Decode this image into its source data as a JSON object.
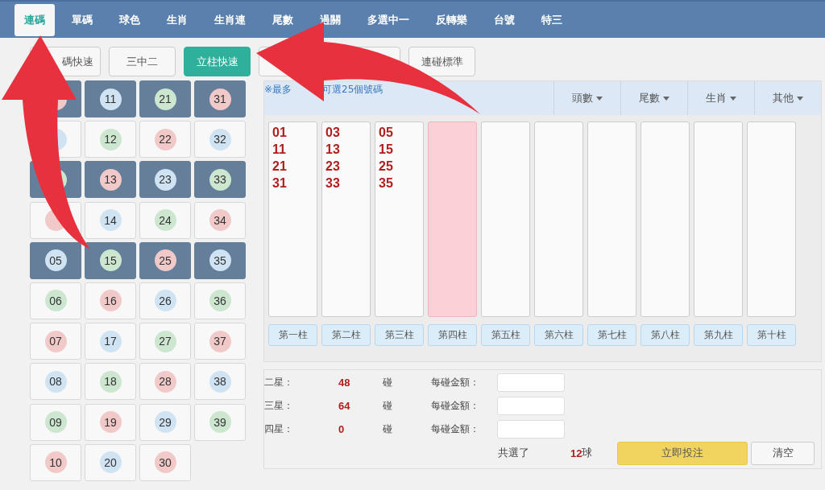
{
  "tabs": [
    {
      "label": "連碼",
      "selected": true
    },
    {
      "label": "單碼",
      "selected": false
    },
    {
      "label": "球色",
      "selected": false
    },
    {
      "label": "生肖",
      "selected": false
    },
    {
      "label": "生肖連",
      "selected": false
    },
    {
      "label": "尾數",
      "selected": false
    },
    {
      "label": "過關",
      "selected": false
    },
    {
      "label": "多選中一",
      "selected": false
    },
    {
      "label": "反轉樂",
      "selected": false
    },
    {
      "label": "台號",
      "selected": false
    },
    {
      "label": "特三",
      "selected": false
    }
  ],
  "mode_buttons": [
    {
      "label": "碼快速",
      "selected": false
    },
    {
      "label": "三中二",
      "selected": false
    },
    {
      "label": "立柱快速",
      "selected": true
    },
    {
      "selected": false
    },
    {
      "label": "連碰標準",
      "selected": false
    }
  ],
  "ball_columns": [
    [
      {
        "color": "#f2c9c9",
        "selected": true
      },
      {
        "color": "#cfe3f3",
        "selected": false
      },
      {
        "color": "#cde6cf",
        "selected": true
      },
      {
        "color": "#f2c9c9",
        "selected": false
      },
      {
        "number": "05",
        "color": "#cfe3f3",
        "selected": true
      },
      {
        "number": "06",
        "color": "#cde6cf",
        "selected": false
      },
      {
        "number": "07",
        "color": "#f2c9c9",
        "selected": false
      },
      {
        "number": "08",
        "color": "#cfe3f3",
        "selected": false
      },
      {
        "number": "09",
        "color": "#cde6cf",
        "selected": false
      },
      {
        "number": "10",
        "color": "#f2c9c9",
        "selected": false
      }
    ],
    [
      {
        "number": "11",
        "color": "#cfe3f3",
        "selected": true
      },
      {
        "number": "12",
        "color": "#cde6cf",
        "selected": false
      },
      {
        "number": "13",
        "color": "#f2c9c9",
        "selected": true
      },
      {
        "number": "14",
        "color": "#cfe3f3",
        "selected": false
      },
      {
        "number": "15",
        "color": "#cde6cf",
        "selected": true
      },
      {
        "number": "16",
        "color": "#f2c9c9",
        "selected": false
      },
      {
        "number": "17",
        "color": "#cfe3f3",
        "selected": false
      },
      {
        "number": "18",
        "color": "#cde6cf",
        "selected": false
      },
      {
        "number": "19",
        "color": "#f2c9c9",
        "selected": false
      },
      {
        "number": "20",
        "color": "#cfe3f3",
        "selected": false
      }
    ],
    [
      {
        "number": "21",
        "color": "#cde6cf",
        "selected": true
      },
      {
        "number": "22",
        "color": "#f2c9c9",
        "selected": false
      },
      {
        "number": "23",
        "color": "#cfe3f3",
        "selected": true
      },
      {
        "number": "24",
        "color": "#cde6cf",
        "selected": false
      },
      {
        "number": "25",
        "color": "#f2c9c9",
        "selected": true
      },
      {
        "number": "26",
        "color": "#cfe3f3",
        "selected": false
      },
      {
        "number": "27",
        "color": "#cde6cf",
        "selected": false
      },
      {
        "number": "28",
        "color": "#f2c9c9",
        "selected": false
      },
      {
        "number": "29",
        "color": "#cfe3f3",
        "selected": false
      },
      {
        "number": "30",
        "color": "#f2c9c9",
        "selected": false
      }
    ],
    [
      {
        "number": "31",
        "color": "#f2c9c9",
        "selected": true
      },
      {
        "number": "32",
        "color": "#cfe3f3",
        "selected": false
      },
      {
        "number": "33",
        "color": "#cde6cf",
        "selected": true
      },
      {
        "number": "34",
        "color": "#f2c9c9",
        "selected": false
      },
      {
        "number": "35",
        "color": "#cfe3f3",
        "selected": true
      },
      {
        "number": "36",
        "color": "#cde6cf",
        "selected": false
      },
      {
        "number": "37",
        "color": "#f2c9c9",
        "selected": false
      },
      {
        "number": "38",
        "color": "#cfe3f3",
        "selected": false
      },
      {
        "number": "39",
        "color": "#cde6cf",
        "selected": false
      }
    ]
  ],
  "notice": [
    "※最多",
    "可選25個號碼"
  ],
  "filters": [
    "頭數",
    "尾數",
    "生肖",
    "其他"
  ],
  "pillars": [
    {
      "label": "第一柱",
      "selected": false,
      "numbers": [
        "01",
        "11",
        "21",
        "31"
      ]
    },
    {
      "label": "第二柱",
      "selected": false,
      "numbers": [
        "03",
        "13",
        "23",
        "33"
      ]
    },
    {
      "label": "第三柱",
      "selected": false,
      "numbers": [
        "05",
        "15",
        "25",
        "35"
      ]
    },
    {
      "label": "第四柱",
      "selected": true
    },
    {
      "label": "第五柱",
      "selected": false
    },
    {
      "label": "第六柱",
      "selected": false
    },
    {
      "label": "第七柱",
      "selected": false
    },
    {
      "label": "第八柱",
      "selected": false
    },
    {
      "label": "第九柱",
      "selected": false
    },
    {
      "label": "第十柱",
      "selected": false
    }
  ],
  "stakes": [
    {
      "label": "二星：",
      "count": "48",
      "unit": "碰",
      "amount_label": "每碰金額："
    },
    {
      "label": "三星：",
      "count": "64",
      "unit": "碰",
      "amount_label": "每碰金額："
    },
    {
      "label": "四星：",
      "count": "0",
      "unit": "碰",
      "amount_label": "每碰金額："
    }
  ],
  "summary": {
    "label": "共選了",
    "count": "12",
    "unit": "球"
  },
  "buttons": {
    "submit": "立即投注",
    "clear": "清空"
  }
}
